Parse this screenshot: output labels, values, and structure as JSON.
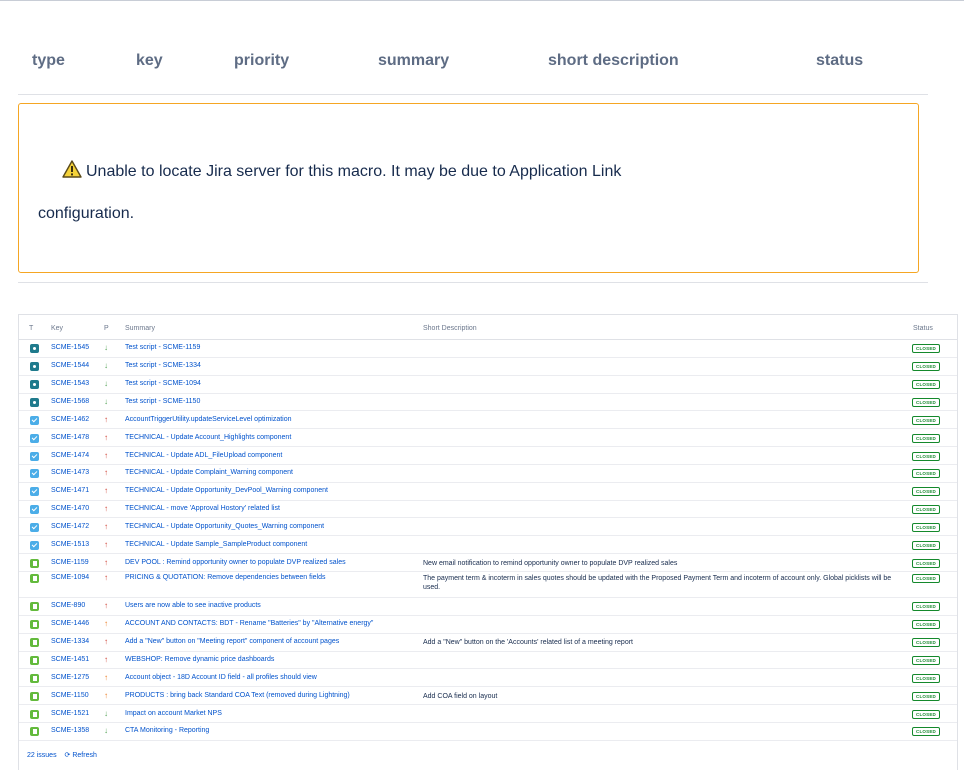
{
  "macro_header": {
    "columns": [
      "type",
      "key",
      "priority",
      "summary",
      "short description",
      "status"
    ]
  },
  "warning": {
    "icon": "warning-icon",
    "line1": "Unable to locate Jira server for this macro. It may be due to Application Link",
    "line2": "configuration.",
    "border_color": "#f5a623"
  },
  "issues_table": {
    "headers": {
      "t": "T",
      "key": "Key",
      "p": "P",
      "summary": "Summary",
      "short_description": "Short Description",
      "status": "Status"
    },
    "rows": [
      {
        "type": "test",
        "key": "SCME-1545",
        "priority": "down",
        "summary": "Test script - SCME-1159",
        "desc": "",
        "status": "CLOSED"
      },
      {
        "type": "test",
        "key": "SCME-1544",
        "priority": "down",
        "summary": "Test script - SCME-1334",
        "desc": "",
        "status": "CLOSED"
      },
      {
        "type": "test",
        "key": "SCME-1543",
        "priority": "down",
        "summary": "Test script - SCME-1094",
        "desc": "",
        "status": "CLOSED"
      },
      {
        "type": "test",
        "key": "SCME-1568",
        "priority": "down",
        "summary": "Test script - SCME-1150",
        "desc": "",
        "status": "CLOSED"
      },
      {
        "type": "task",
        "key": "SCME-1462",
        "priority": "up-high",
        "summary": "AccountTriggerUtility.updateServiceLevel optimization",
        "desc": "",
        "status": "CLOSED"
      },
      {
        "type": "task",
        "key": "SCME-1478",
        "priority": "up-high",
        "summary": "TECHNICAL - Update Account_Highlights component",
        "desc": "",
        "status": "CLOSED"
      },
      {
        "type": "task",
        "key": "SCME-1474",
        "priority": "up-high",
        "summary": "TECHNICAL - Update ADL_FileUpload component",
        "desc": "",
        "status": "CLOSED"
      },
      {
        "type": "task",
        "key": "SCME-1473",
        "priority": "up-high",
        "summary": "TECHNICAL - Update Complaint_Warning component",
        "desc": "",
        "status": "CLOSED"
      },
      {
        "type": "task",
        "key": "SCME-1471",
        "priority": "up-high",
        "summary": "TECHNICAL - Update Opportunity_DevPool_Warning component",
        "desc": "",
        "status": "CLOSED"
      },
      {
        "type": "task",
        "key": "SCME-1470",
        "priority": "up-high",
        "summary": "TECHNICAL - move 'Approval Hostory' related list",
        "desc": "",
        "status": "CLOSED"
      },
      {
        "type": "task",
        "key": "SCME-1472",
        "priority": "up-high",
        "summary": "TECHNICAL - Update Opportunity_Quotes_Warning component",
        "desc": "",
        "status": "CLOSED"
      },
      {
        "type": "task",
        "key": "SCME-1513",
        "priority": "up-high",
        "summary": "TECHNICAL - Update Sample_SampleProduct component",
        "desc": "",
        "status": "CLOSED"
      },
      {
        "type": "story",
        "key": "SCME-1159",
        "priority": "up-high",
        "summary": "DEV POOL : Remind opportunity owner to populate DVP realized sales",
        "desc": "New email notification to remind opportunity owner to populate DVP realized sales",
        "status": "CLOSED"
      },
      {
        "type": "story",
        "key": "SCME-1094",
        "priority": "up-high",
        "summary": "PRICING & QUOTATION: Remove dependencies between fields",
        "desc": "The payment term & incoterm in sales quotes should be updated with the Proposed Payment Term and incoterm of account only. Global picklists will be used.",
        "status": "CLOSED"
      },
      {
        "type": "story",
        "key": "SCME-890",
        "priority": "up-high",
        "summary": "Users are now able to see inactive products",
        "desc": "",
        "status": "CLOSED"
      },
      {
        "type": "story",
        "key": "SCME-1446",
        "priority": "up-med",
        "summary": "ACCOUNT AND CONTACTS: BDT - Rename \"Batteries\" by \"Alternative energy\"",
        "desc": "",
        "status": "CLOSED"
      },
      {
        "type": "story",
        "key": "SCME-1334",
        "priority": "up-high",
        "summary": "Add a \"New\" button on \"Meeting report\" component of account pages",
        "desc": "Add a \"New\" button on the 'Accounts' related list of a meeting report",
        "status": "CLOSED"
      },
      {
        "type": "story",
        "key": "SCME-1451",
        "priority": "up-high",
        "summary": "WEBSHOP: Remove dynamic price dashboards",
        "desc": "",
        "status": "CLOSED"
      },
      {
        "type": "story",
        "key": "SCME-1275",
        "priority": "up-med",
        "summary": "Account object - 18D Account ID field - all profiles should view",
        "desc": "",
        "status": "CLOSED"
      },
      {
        "type": "story",
        "key": "SCME-1150",
        "priority": "up-med",
        "summary": "PRODUCTS : bring back Standard COA Text (removed during Lightning)",
        "desc": "Add COA field on layout",
        "status": "CLOSED"
      },
      {
        "type": "story",
        "key": "SCME-1521",
        "priority": "down",
        "summary": "Impact on account Market NPS",
        "desc": "",
        "status": "CLOSED"
      },
      {
        "type": "story",
        "key": "SCME-1358",
        "priority": "down",
        "summary": "CTA Monitoring - Reporting",
        "desc": "",
        "status": "CLOSED"
      }
    ],
    "footer": {
      "count": "22 issues",
      "refresh_icon": "refresh-icon",
      "refresh": "Refresh"
    },
    "colors": {
      "link": "#0052cc",
      "closed": "#14892c",
      "priority_high": "#d04437",
      "priority_medium": "#ea7d24",
      "priority_low": "#57a55a"
    }
  }
}
